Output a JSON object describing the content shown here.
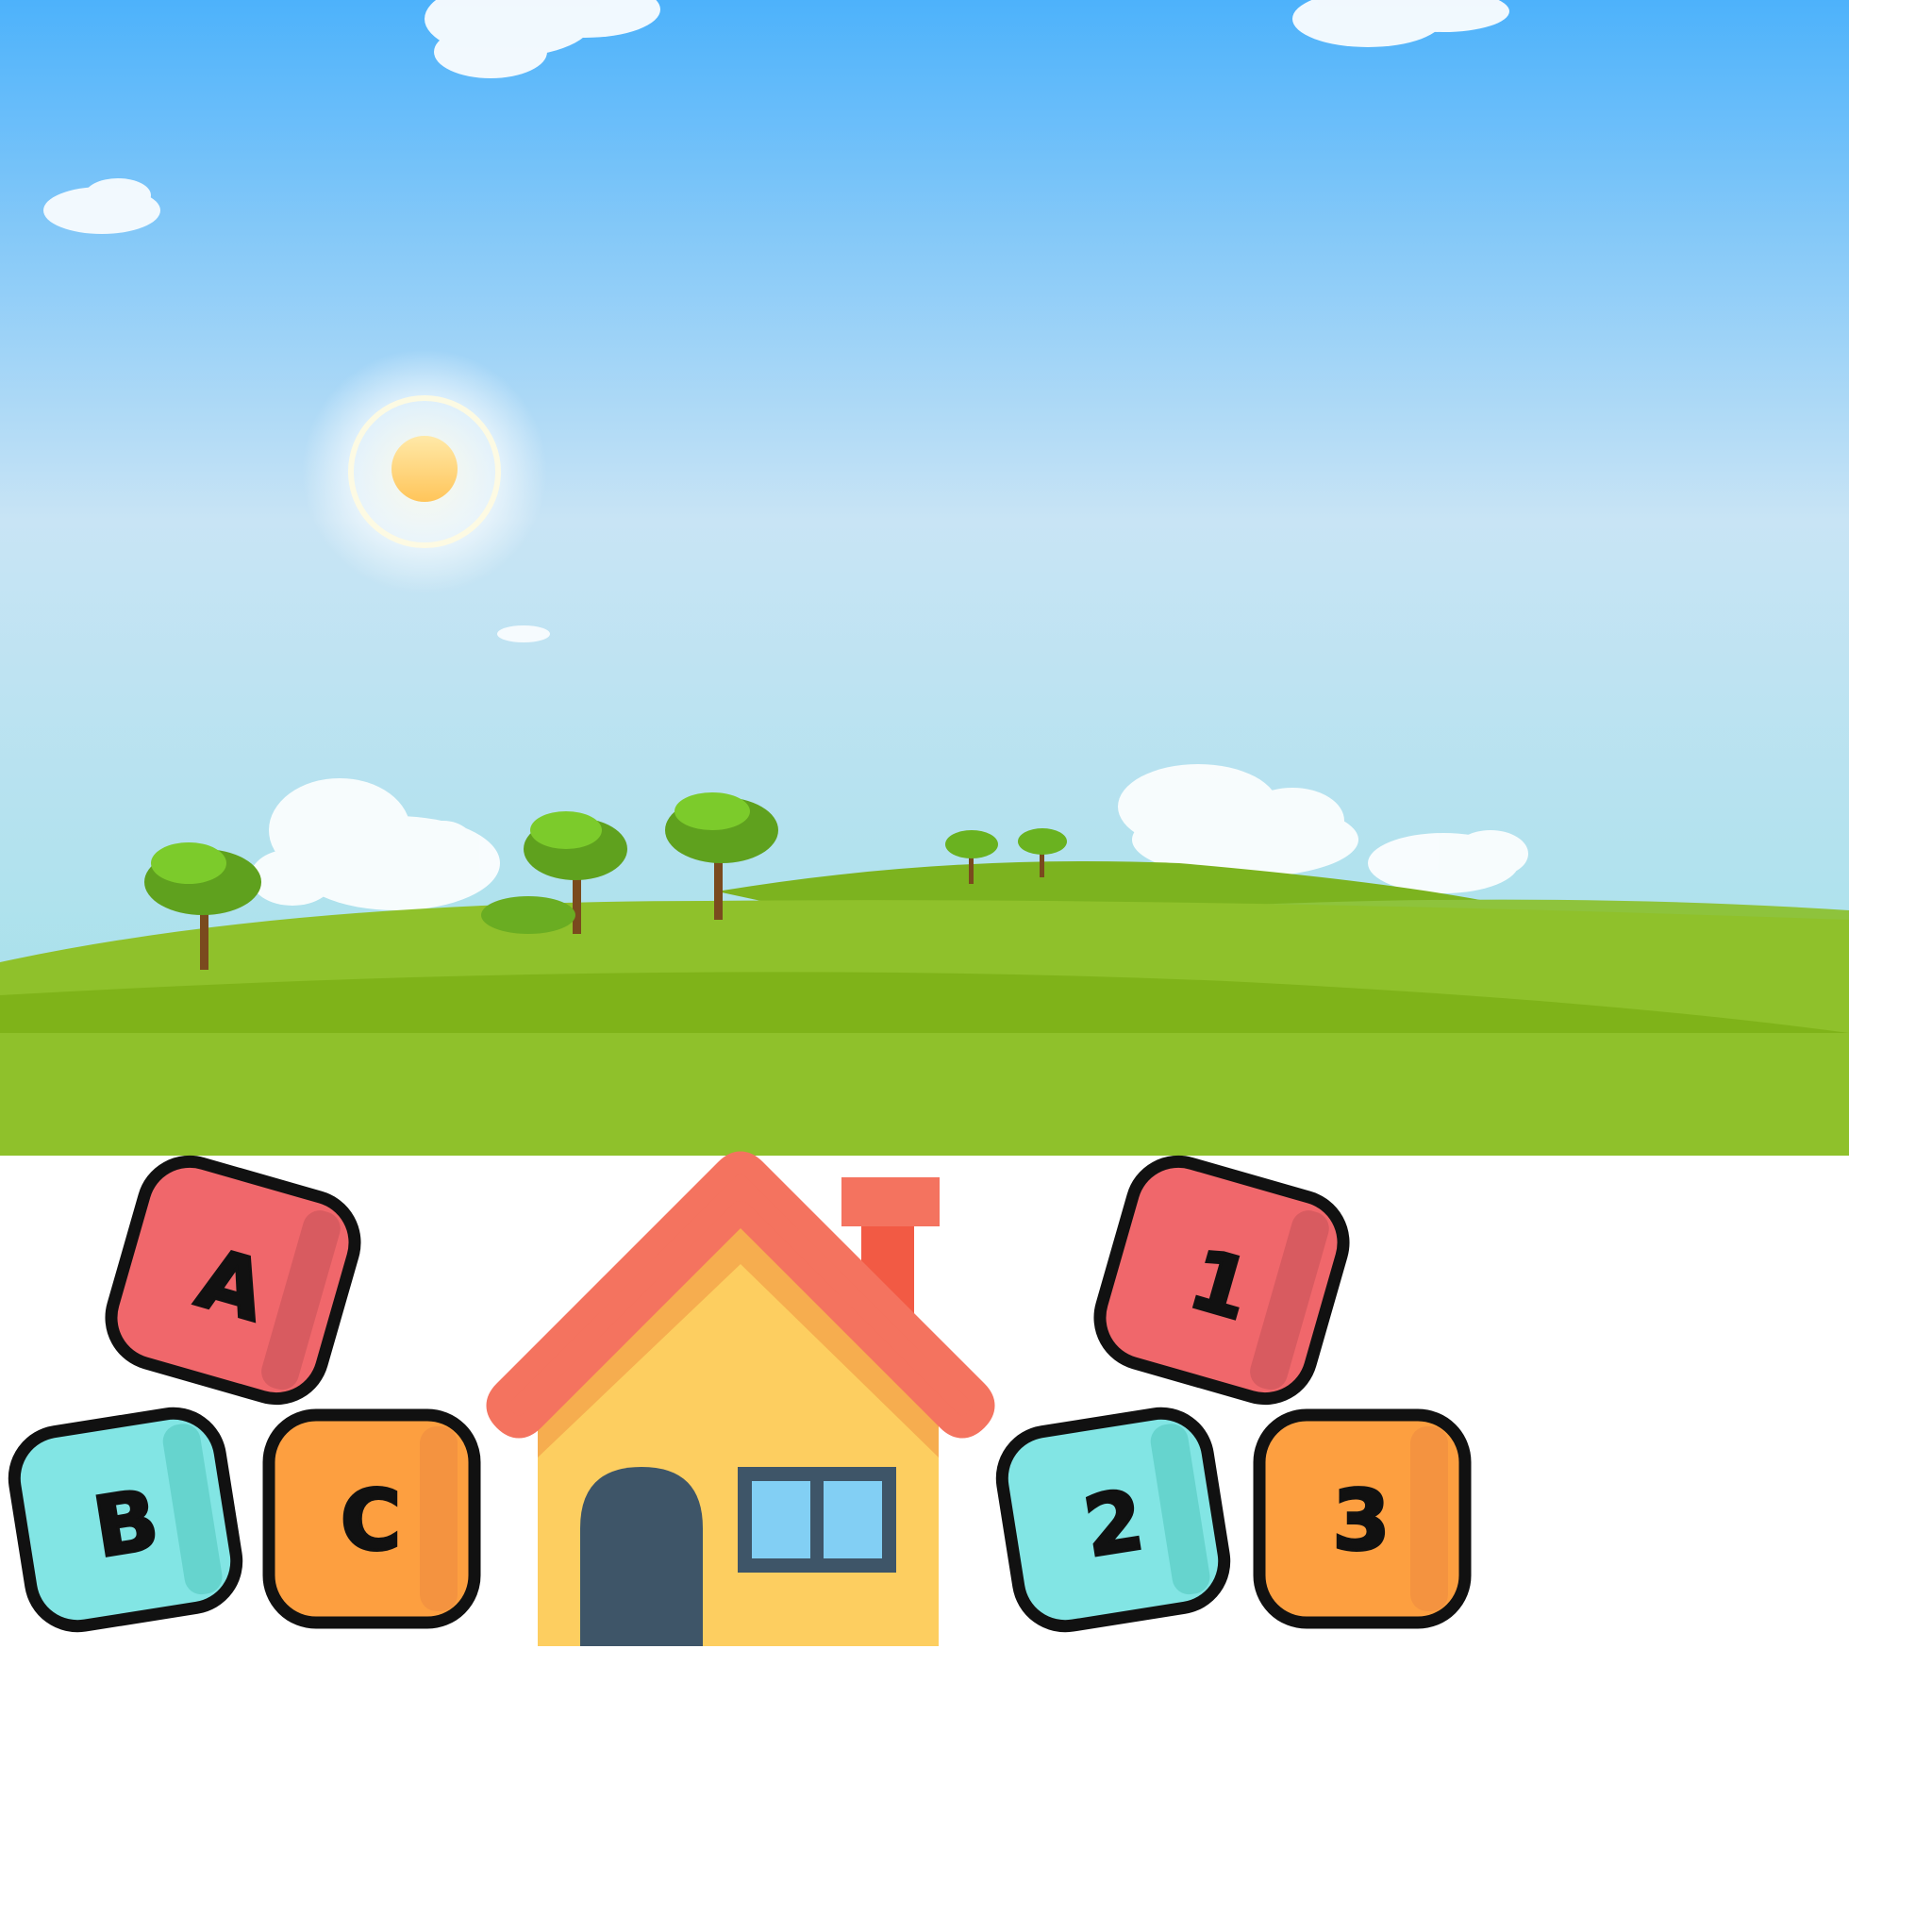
{
  "scene": {
    "sky_top_color": "#4db2fb",
    "sky_bottom_color": "#9fe0e8",
    "grass_color": "#8fc12b",
    "sun_color": "#ffd277"
  },
  "icons": {
    "house": "house-icon",
    "sun": "sun-icon",
    "tree": "tree-icon",
    "cloud": "cloud-icon"
  },
  "letter_blocks": [
    {
      "text": "A",
      "color": "#f0676b",
      "shade": "#d85b60"
    },
    {
      "text": "B",
      "color": "#82e5e4",
      "shade": "#66d4ce"
    },
    {
      "text": "C",
      "color": "#fd9f40",
      "shade": "#f49340"
    }
  ],
  "number_blocks": [
    {
      "text": "1",
      "color": "#f0676b",
      "shade": "#d85b60"
    },
    {
      "text": "2",
      "color": "#82e5e4",
      "shade": "#66d4ce"
    },
    {
      "text": "3",
      "color": "#fd9f40",
      "shade": "#f49340"
    }
  ],
  "house_colors": {
    "roof": "#f4735f",
    "wall": "#fdce60",
    "door": "#3e5568",
    "window": "#82cff4",
    "chimney": "#f25a44"
  }
}
